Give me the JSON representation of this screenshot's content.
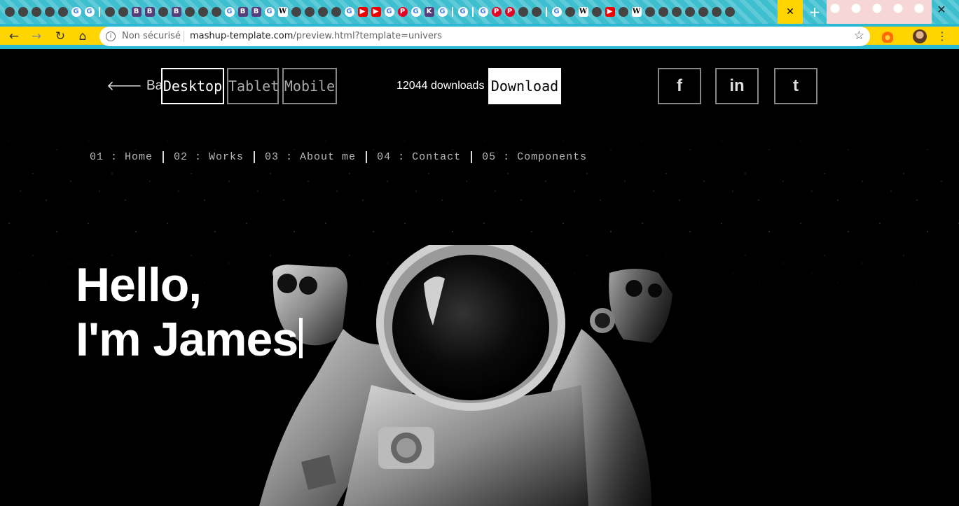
{
  "browser": {
    "active_tab_close": "✕",
    "new_tab": "+",
    "window_close": "✕",
    "favicons": [
      "globe",
      "globe",
      "globe",
      "globe",
      "globe",
      "G",
      "G",
      "sep",
      "globe",
      "globe",
      "B",
      "B",
      "globe",
      "B",
      "globe",
      "globe",
      "globe",
      "G",
      "B",
      "B",
      "G",
      "W",
      "globe",
      "globe",
      "globe",
      "globe",
      "G",
      "YT",
      "YT",
      "G",
      "P",
      "G",
      "K",
      "G",
      "sep",
      "G",
      "sep",
      "G",
      "P",
      "P",
      "globe",
      "globe",
      "sep",
      "G",
      "globe",
      "W",
      "globe",
      "YT",
      "globe",
      "W",
      "globe",
      "globe",
      "globe",
      "globe",
      "globe",
      "globe",
      "globe"
    ]
  },
  "address_bar": {
    "security_label": "Non sécurisé",
    "url_host": "mashup-template.com",
    "url_path": "/preview.html?template=univers"
  },
  "preview_bar": {
    "back_label": "Back",
    "devices": [
      "Desktop",
      "Tablet",
      "Mobile"
    ],
    "active_device": "Desktop",
    "downloads_text": "12044 downloads",
    "download_label": "Download",
    "social": [
      "f",
      "in",
      "t"
    ]
  },
  "site": {
    "nav": [
      "01 : Home",
      "02 : Works",
      "03 : About me",
      "04 : Contact",
      "05 : Components"
    ],
    "hero_line1": "Hello,",
    "hero_line2": "I'm James"
  }
}
